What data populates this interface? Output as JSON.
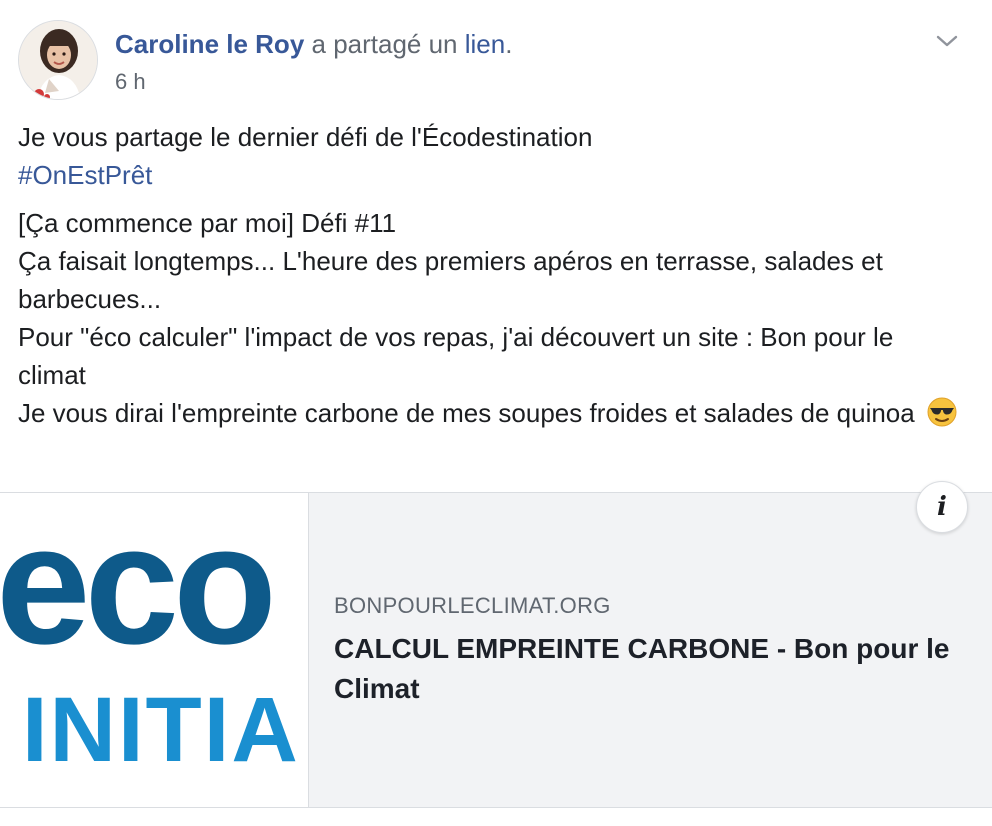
{
  "post": {
    "author": "Caroline le Roy",
    "action_text": " a partagé un ",
    "action_link": "lien",
    "action_end": ".",
    "timestamp": "6 h",
    "avatar_icon": "profile-photo",
    "menu_icon": "chevron-down-icon"
  },
  "message": {
    "line1": "Je vous partage le dernier défi de l'Écodestination",
    "hashtag": "#OnEstPrêt",
    "para2_line1": "[Ça commence par moi] Défi #11",
    "para2_line2": "Ça faisait longtemps... L'heure des premiers apéros en terrasse, salades et barbecues...",
    "para2_line3": "Pour \"éco calculer\" l'impact de vos repas, j'ai découvert un site : Bon pour le climat",
    "para2_line4": "Je vous dirai l'empreinte carbone de mes soupes froides et salades de quinoa",
    "emoji_icon": "sunglasses-emoji-icon"
  },
  "link_preview": {
    "image_text_top": "eco",
    "image_text_bottom": "INITIA",
    "domain": "BONPOURLECLIMAT.ORG",
    "title": "CALCUL EMPREINTE CARBONE - Bon pour le Climat",
    "info_label": "i",
    "brand_color": "#0e5a8a",
    "brand_color_light": "#1a8fd0"
  }
}
